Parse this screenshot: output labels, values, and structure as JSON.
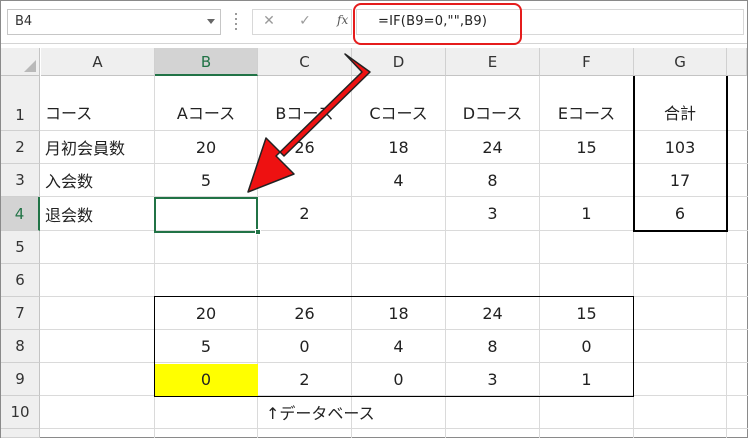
{
  "name_box": {
    "value": "B4"
  },
  "formula_bar": {
    "cancel_icon": "✕",
    "enter_icon": "✓",
    "fx_label": "fx",
    "formula": "=IF(B9=0,\"\",B9)"
  },
  "columns": [
    "A",
    "B",
    "C",
    "D",
    "E",
    "F",
    "G"
  ],
  "rows": [
    "1",
    "2",
    "3",
    "4",
    "5",
    "6",
    "7",
    "8",
    "9",
    "10"
  ],
  "selected_cell": "B4",
  "sheet": {
    "header": [
      "コース",
      "Aコース",
      "Bコース",
      "Cコース",
      "Dコース",
      "Eコース",
      "合計"
    ],
    "monthly_members": {
      "label": "月初会員数",
      "values": [
        "20",
        "26",
        "18",
        "24",
        "15"
      ],
      "total": "103"
    },
    "joined": {
      "label": "入会数",
      "values": [
        "5",
        "",
        "4",
        "8",
        ""
      ],
      "total": "17"
    },
    "left": {
      "label": "退会数",
      "values": [
        "",
        "2",
        "",
        "3",
        "1"
      ],
      "total": "6"
    }
  },
  "database": {
    "rows": [
      [
        "20",
        "26",
        "18",
        "24",
        "15"
      ],
      [
        "5",
        "0",
        "4",
        "8",
        "0"
      ],
      [
        "0",
        "2",
        "0",
        "3",
        "1"
      ]
    ],
    "caption": "↑データベース",
    "highlight_color": "#ffff00"
  },
  "colors": {
    "accent_green": "#217346",
    "arrow_red": "#ee1111",
    "formula_highlight": "#e51c1c"
  },
  "annotation": {
    "arrow_icon": "red-arrow-pointing-to-b4"
  }
}
